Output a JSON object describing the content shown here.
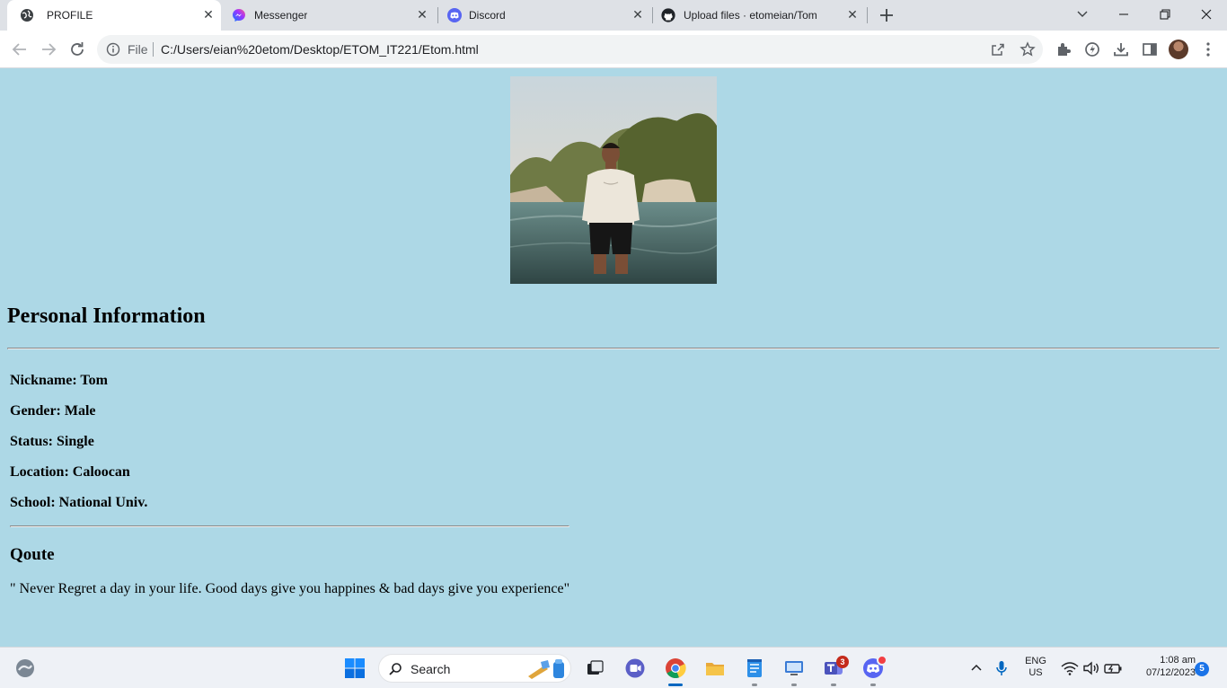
{
  "browser": {
    "tabs": [
      {
        "title": "PROFILE",
        "icon": "globe-icon",
        "active": true
      },
      {
        "title": "Messenger",
        "icon": "messenger-icon",
        "active": false
      },
      {
        "title": "Discord",
        "icon": "discord-icon",
        "active": false
      },
      {
        "title": "Upload files · etomeian/Tom",
        "icon": "github-icon",
        "active": false
      }
    ],
    "omnibox": {
      "scheme_label": "File",
      "url": "C:/Users/eian%20etom/Desktop/ETOM_IT221/Etom.html"
    }
  },
  "page": {
    "heading": "Personal Information",
    "info_rows": [
      "Nickname: Tom",
      "Gender: Male",
      "Status: Single",
      "Location: Caloocan",
      "School: National Univ."
    ],
    "quote_heading": "Qoute",
    "quote_text": "\" Never Regret a day in your life. Good days give you happines & bad days give you experience\""
  },
  "taskbar": {
    "search_label": "Search",
    "teams_badge": "3",
    "language": "ENG",
    "region": "US",
    "time": "1:08 am",
    "date": "07/12/2023",
    "notification_count": "5"
  },
  "colors": {
    "page_background": "#add8e6",
    "tabstrip_background": "#dee1e6",
    "notification_badge": "#1a73e8"
  }
}
